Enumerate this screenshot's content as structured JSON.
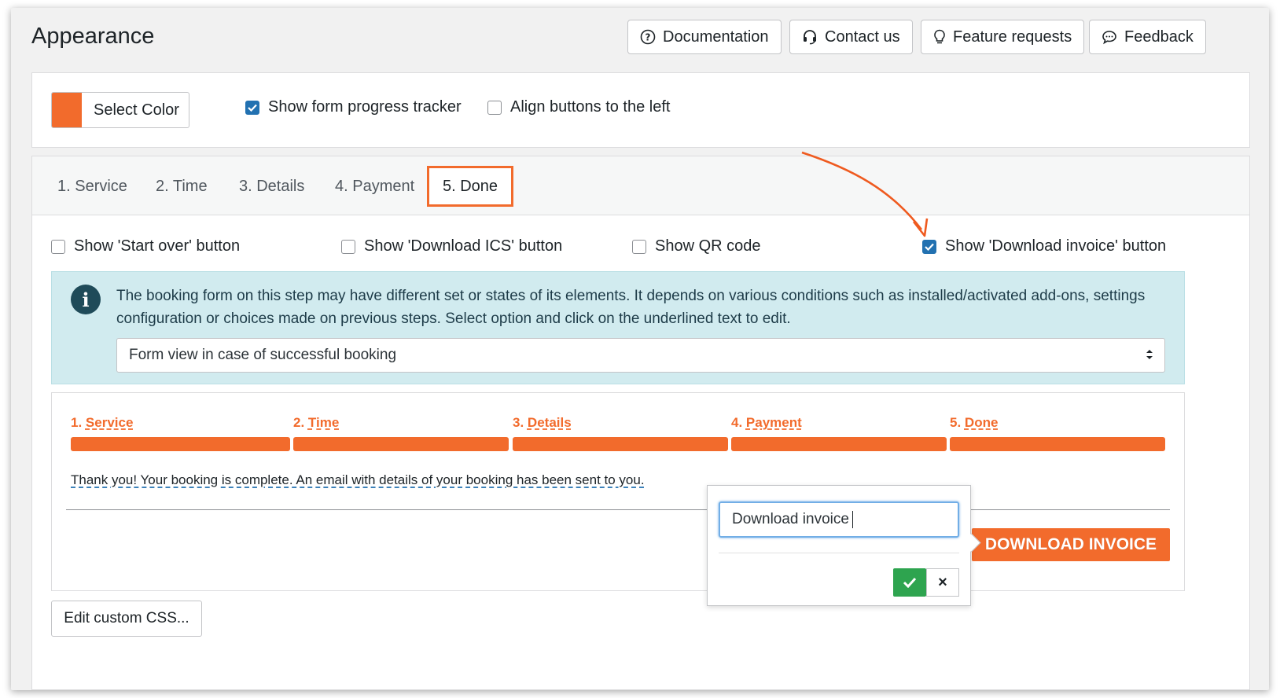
{
  "page": {
    "title": "Appearance"
  },
  "header_buttons": {
    "documentation": "Documentation",
    "contact": "Contact us",
    "feature_requests": "Feature requests",
    "feedback": "Feedback"
  },
  "colors": {
    "accent": "#f26b2c",
    "checkbox": "#2271b1",
    "info_bg": "#d1ebef",
    "ok": "#2ea44f"
  },
  "general": {
    "select_color_label": "Select Color",
    "swatch_color": "#f26b2c",
    "show_progress_tracker": {
      "label": "Show form progress tracker",
      "checked": true
    },
    "align_left": {
      "label": "Align buttons to the left",
      "checked": false
    }
  },
  "tabs": [
    {
      "label": "1. Service",
      "active": false
    },
    {
      "label": "2. Time",
      "active": false
    },
    {
      "label": "3. Details",
      "active": false
    },
    {
      "label": "4. Payment",
      "active": false
    },
    {
      "label": "5. Done",
      "active": true
    }
  ],
  "done_options": [
    {
      "label": "Show 'Start over' button",
      "checked": false
    },
    {
      "label": "Show 'Download ICS' button",
      "checked": false
    },
    {
      "label": "Show QR code",
      "checked": false
    },
    {
      "label": "Show 'Download invoice' button",
      "checked": true
    }
  ],
  "info": {
    "text": "The booking form on this step may have different set or states of its elements. It depends on various conditions such as installed/activated add-ons, settings configuration or choices made on previous steps. Select option and click on the underlined text to edit.",
    "select_value": "Form view in case of successful booking"
  },
  "preview": {
    "steps": [
      {
        "num": "1.",
        "label": "Service"
      },
      {
        "num": "2.",
        "label": "Time"
      },
      {
        "num": "3.",
        "label": "Details"
      },
      {
        "num": "4.",
        "label": "Payment"
      },
      {
        "num": "5.",
        "label": "Done"
      }
    ],
    "thanks_text": "Thank you! Your booking is complete. An email with details of your booking has been sent to you.",
    "download_button": "DOWNLOAD INVOICE"
  },
  "popover": {
    "input_value": "Download invoice",
    "cancel_symbol": "×"
  },
  "footer": {
    "edit_css": "Edit custom CSS..."
  }
}
